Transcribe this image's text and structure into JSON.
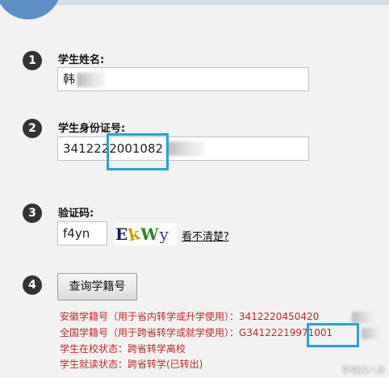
{
  "steps": [
    {
      "number": "1",
      "label": "学生姓名:",
      "value": "韩"
    },
    {
      "number": "2",
      "label": "学生身份证号:",
      "value": "3412222001082"
    },
    {
      "number": "3",
      "label": "验证码:",
      "value": "f4yn",
      "captcha_chars": [
        "E",
        "k",
        "W",
        "y"
      ],
      "refresh_link": "看不清楚?"
    },
    {
      "number": "4",
      "button_label": "查询学籍号"
    }
  ],
  "results": {
    "anhui_id": "安徽学籍号（用于省内转学或升学使用）：3412220450420",
    "national_id": "全国学籍号（用于跨省转学或就学使用）：G34122219971001",
    "school_status": "学生在校状态：跨省转学离校",
    "study_status": "学生就读状态：跨省转学(已转出)"
  },
  "watermark": "草莓的八卦",
  "colors": {
    "accent": "#2aa3cf",
    "result_text": "#c0282c",
    "badge": "#333333"
  }
}
